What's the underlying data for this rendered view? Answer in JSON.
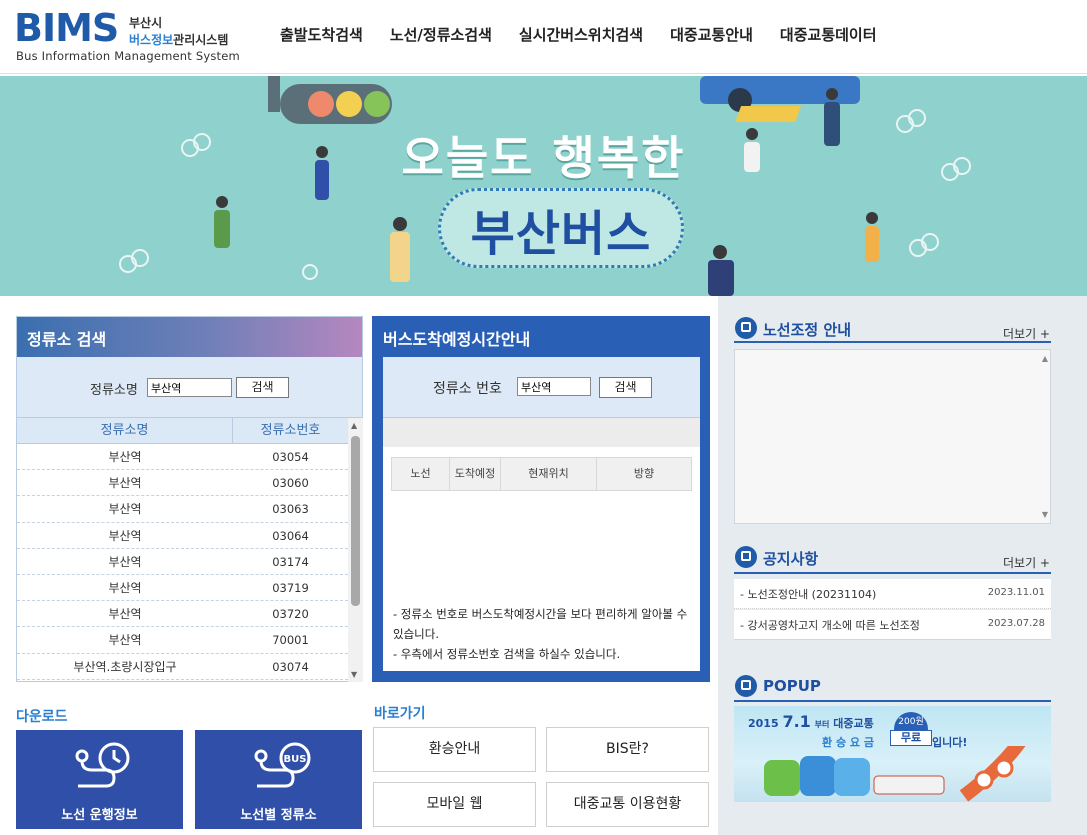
{
  "header": {
    "logo_text": "BIMS",
    "city": "부산시",
    "system_blue": "버스정보",
    "system_rest": "관리시스템",
    "subtitle": "Bus Information Management System",
    "nav": [
      "출발도착검색",
      "노선/정류소검색",
      "실시간버스위치검색",
      "대중교통안내",
      "대중교통데이터"
    ]
  },
  "banner": {
    "line1": "오늘도 행복한",
    "line2": "부산버스",
    "colors": {
      "background": "#8fd1cc",
      "title": "#ffffff",
      "accent": "#1f4fa0"
    }
  },
  "stop_search": {
    "title": "정류소 검색",
    "label": "정류소명",
    "input_value": "부산역",
    "button": "검색",
    "columns": [
      "정류소명",
      "정류소번호"
    ],
    "rows": [
      [
        "부산역",
        "03054"
      ],
      [
        "부산역",
        "03060"
      ],
      [
        "부산역",
        "03063"
      ],
      [
        "부산역",
        "03064"
      ],
      [
        "부산역",
        "03174"
      ],
      [
        "부산역",
        "03719"
      ],
      [
        "부산역",
        "03720"
      ],
      [
        "부산역",
        "70001"
      ],
      [
        "부산역.초량시장입구",
        "03074"
      ]
    ]
  },
  "arrival": {
    "title": "버스도착예정시간안내",
    "label": "정류소 번호",
    "input_value": "부산역",
    "button": "검색",
    "columns": [
      "노선",
      "도착예정",
      "현재위치",
      "방향"
    ],
    "note1": "- 정류소 번호로 버스도착예정시간을 보다 편리하게 알아볼 수 있습니다.",
    "note2": "- 우측에서 정류소번호 검색을 하실수 있습니다."
  },
  "route_notice": {
    "title": "노선조정 안내",
    "more": "더보기 +"
  },
  "notices": {
    "title": "공지사항",
    "more": "더보기 +",
    "items": [
      {
        "title": "- 노선조정안내 (20231104)",
        "date": "2023.11.01"
      },
      {
        "title": "- 강서공영차고지 개소에 따른 노선조정",
        "date": "2023.07.28"
      }
    ]
  },
  "popup": {
    "title": "POPUP",
    "year": "2015",
    "date": "7.1",
    "from": "부터",
    "brand": "대중교통",
    "transfer": "환 승 요 금",
    "badge": "200원",
    "free": "무료",
    "end": "입니다!"
  },
  "downloads": {
    "title": "다운로드",
    "items": [
      "노선 운행정보",
      "노선별 정류소"
    ]
  },
  "shortcuts": {
    "title": "바로가기",
    "items": [
      "환승안내",
      "BIS란?",
      "모바일 웹",
      "대중교통 이용현황"
    ]
  }
}
